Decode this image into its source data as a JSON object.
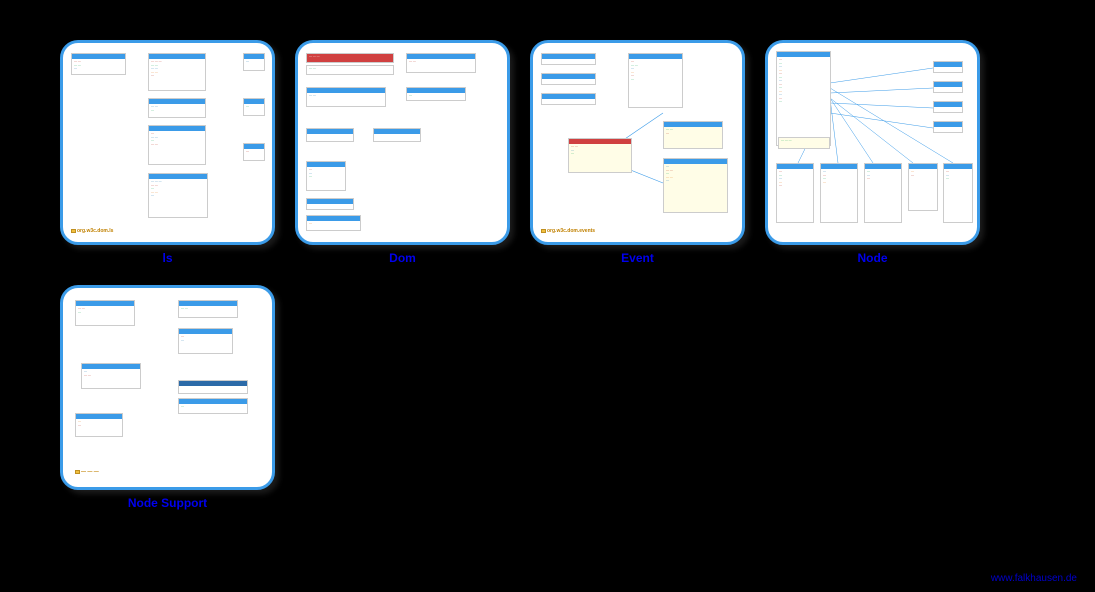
{
  "thumbnails": [
    {
      "label": "ls",
      "package": "org.w3c.dom.ls"
    },
    {
      "label": "Dom",
      "package": ""
    },
    {
      "label": "Event",
      "package": "org.w3c.dom.events"
    },
    {
      "label": "Node",
      "package": ""
    },
    {
      "label": "Node Support",
      "package": ""
    }
  ],
  "footer": "www.falkhausen.de"
}
